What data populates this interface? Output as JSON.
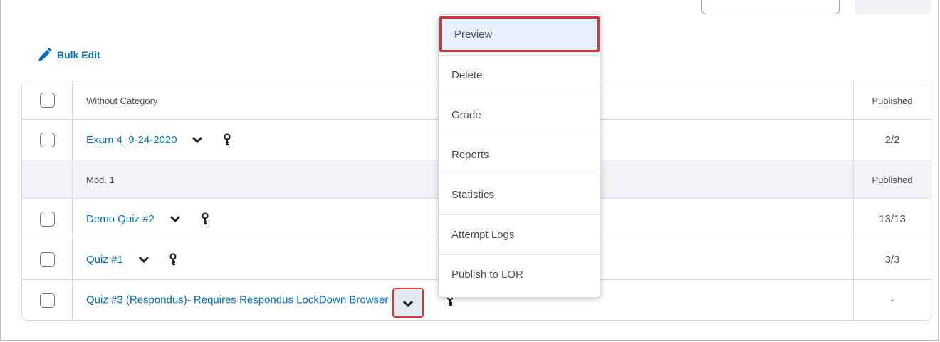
{
  "bulk_edit": {
    "label": "Bulk Edit",
    "icon": "pencil-icon"
  },
  "rows": [
    {
      "kind": "category",
      "name": "Without Category",
      "status": "Published",
      "shaded": false
    },
    {
      "kind": "quiz",
      "name": "Exam 4_9-24-2020",
      "status": "2/2"
    },
    {
      "kind": "category",
      "name": "Mod. 1",
      "status": "Published",
      "shaded": true
    },
    {
      "kind": "quiz",
      "name": "Demo Quiz #2",
      "status": "13/13"
    },
    {
      "kind": "quiz",
      "name": "Quiz #1",
      "status": "3/3"
    },
    {
      "kind": "quiz",
      "name": "Quiz #3 (Respondus)- Requires Respondus LockDown Browser",
      "status": "-"
    }
  ],
  "menu": {
    "items": [
      "Preview",
      "Delete",
      "Grade",
      "Reports",
      "Statistics",
      "Attempt Logs",
      "Publish to LOR"
    ],
    "highlighted": "Preview"
  },
  "colors": {
    "link": "#006fbf",
    "highlight_border": "#d9343b",
    "menu_highlight_bg": "#e7f1fb"
  }
}
